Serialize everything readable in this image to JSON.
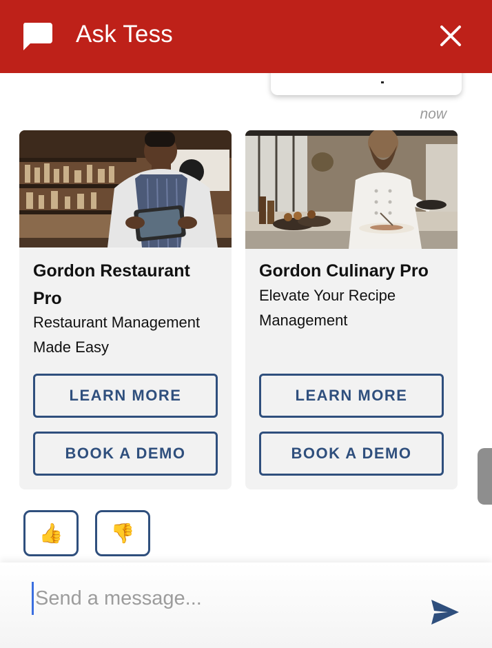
{
  "header": {
    "title": "Ask Tess",
    "chat_icon": "chat-bubble-icon",
    "close_icon": "close-icon",
    "background": "#be2119"
  },
  "messages": {
    "timestamp": "now",
    "cards": [
      {
        "image": "waiter-with-tablet-photo",
        "title": "Gordon Restaurant Pro",
        "subtitle": "Restaurant Management Made Easy",
        "learn_more_label": "LEARN MORE",
        "book_demo_label": "BOOK A DEMO"
      },
      {
        "image": "chef-plating-photo",
        "title": "Gordon Culinary Pro",
        "subtitle": "Elevate Your Recipe Management",
        "learn_more_label": "LEARN MORE",
        "book_demo_label": "BOOK A DEMO"
      }
    ],
    "feedback": {
      "thumbs_up": "👍",
      "thumbs_down": "👎"
    }
  },
  "composer": {
    "placeholder": "Send a message...",
    "value": "",
    "send_icon": "send-icon"
  },
  "colors": {
    "accent": "#2f4f7d",
    "card_background": "#f2f2f2"
  }
}
